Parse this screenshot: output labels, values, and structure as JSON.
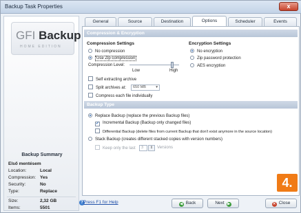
{
  "window": {
    "title": "Backup Task Properties",
    "close_label": "x"
  },
  "logo": {
    "gfi": "GFI",
    "backup": "Backup",
    "subtitle": "HOME EDITION"
  },
  "tabs": [
    {
      "label": "General",
      "active": false
    },
    {
      "label": "Source",
      "active": false
    },
    {
      "label": "Destination",
      "active": false
    },
    {
      "label": "Options",
      "active": true
    },
    {
      "label": "Scheduler",
      "active": false
    },
    {
      "label": "Events",
      "active": false
    }
  ],
  "compression_section": {
    "header": "Compression & Encryption",
    "compression_settings": {
      "title": "Compression Settings",
      "no_compression": "No compression",
      "use_zip": "Use Zip compression",
      "compression_level_label": "Compression Level:",
      "low": "Low",
      "high": "High",
      "self_extracting": "Self extracting archive",
      "split_archives": "Split archives at:",
      "split_value": "650 MB",
      "compress_each": "Compress each file individually"
    },
    "encryption_settings": {
      "title": "Encryption Settings",
      "no_encryption": "No encryption",
      "zip_password": "Zip password protection",
      "aes": "AES encryption"
    }
  },
  "backup_type": {
    "header": "Backup Type",
    "replace": "Replace Backup (replace the previous Backup files)",
    "incremental": "Incremental Backup (Backup only changed files)",
    "differential": "Differential Backup (delete files from current Backup that don't exist anymore in the source location)",
    "stack": "Stack Backup (creates different stacked copies with version numbers)",
    "keep_only_prefix": "Keep only the last",
    "keep_value": "3",
    "keep_suffix": "Versions"
  },
  "summary": {
    "title": "Backup Summary",
    "name": "Első mentésem",
    "rows": [
      {
        "key": "Location:",
        "value": "Local"
      },
      {
        "key": "Compression:",
        "value": "Yes"
      },
      {
        "key": "Security:",
        "value": "No"
      },
      {
        "key": "Type:",
        "value": "Replace"
      },
      {
        "key": "Size:",
        "value": "2,32 GB"
      },
      {
        "key": "Items:",
        "value": "5501"
      }
    ]
  },
  "footer": {
    "help": "Press F1 for Help",
    "back": "Back",
    "next": "Next",
    "close": "Close"
  },
  "badge": "4."
}
